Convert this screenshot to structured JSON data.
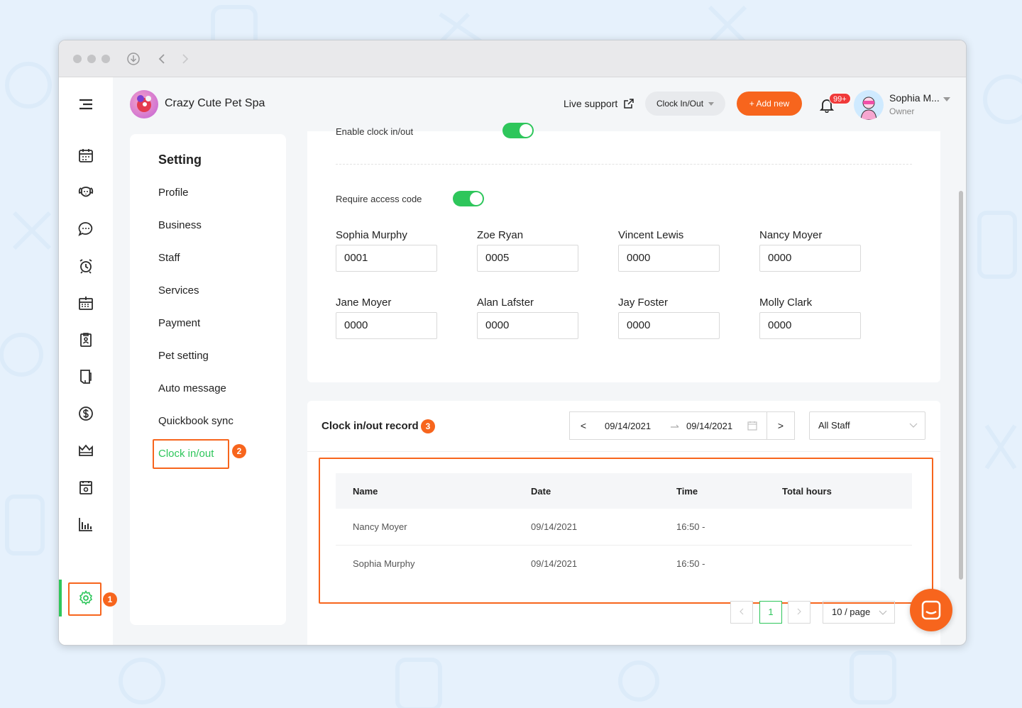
{
  "brand": {
    "name": "Crazy Cute Pet Spa"
  },
  "topbar": {
    "live_support": "Live support",
    "clock_select": "Clock In/Out",
    "add_new": "+ Add new",
    "notifications": "99+",
    "user_name": "Sophia M...",
    "user_role": "Owner"
  },
  "colors": {
    "accent_green": "#2ec65b",
    "accent_orange": "#f7651d",
    "badge_red": "#f03a3a"
  },
  "sidebar_icons": [
    "menu-icon",
    "calendar-icon",
    "dog-icon",
    "chat-icon",
    "alarm-clock-icon",
    "schedule-icon",
    "badge-icon",
    "tablet-icon",
    "dollar-icon",
    "crown-icon",
    "date-card-icon",
    "bar-chart-icon",
    "gear-icon"
  ],
  "settings": {
    "title": "Setting",
    "items": [
      {
        "label": "Profile"
      },
      {
        "label": "Business"
      },
      {
        "label": "Staff"
      },
      {
        "label": "Services"
      },
      {
        "label": "Payment"
      },
      {
        "label": "Pet setting"
      },
      {
        "label": "Auto message"
      },
      {
        "label": "Quickbook sync"
      },
      {
        "label": "Clock in/out"
      }
    ]
  },
  "annotations": {
    "one": "1",
    "two": "2",
    "three": "3"
  },
  "clock_settings": {
    "enable_label": "Enable clock in/out",
    "require_code_label": "Require access code",
    "codes": [
      {
        "name": "Sophia Murphy",
        "code": "0001"
      },
      {
        "name": "Zoe Ryan",
        "code": "0005"
      },
      {
        "name": "Vincent Lewis",
        "code": "0000"
      },
      {
        "name": "Nancy Moyer",
        "code": "0000"
      },
      {
        "name": "Jane Moyer",
        "code": "0000"
      },
      {
        "name": "Alan Lafster",
        "code": "0000"
      },
      {
        "name": "Jay Foster",
        "code": "0000"
      },
      {
        "name": "Molly Clark",
        "code": "0000"
      }
    ]
  },
  "record": {
    "title": "Clock in/out record",
    "prev": "<",
    "next": ">",
    "start_date": "09/14/2021",
    "end_date": "09/14/2021",
    "staff_filter": "All Staff",
    "columns": [
      "Name",
      "Date",
      "Time",
      "Total hours"
    ],
    "rows": [
      {
        "name": "Nancy Moyer",
        "date": "09/14/2021",
        "time": "16:50 -",
        "total": ""
      },
      {
        "name": "Sophia Murphy",
        "date": "09/14/2021",
        "time": "16:50 -",
        "total": ""
      }
    ],
    "pagination": {
      "page": "1",
      "page_size": "10 / page"
    }
  }
}
